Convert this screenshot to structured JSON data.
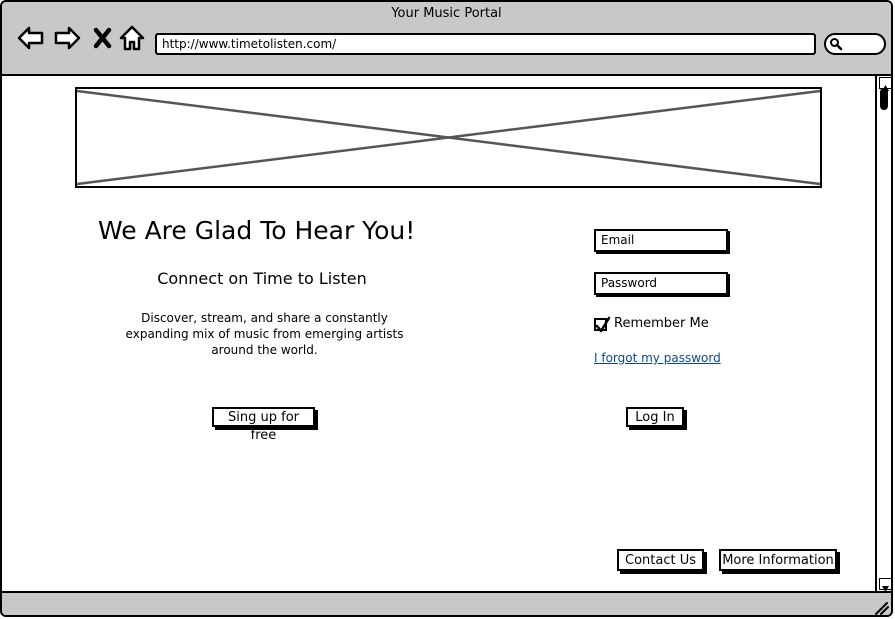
{
  "window": {
    "title": "Your Music Portal"
  },
  "browser": {
    "url": "http://www.timetolisten.com/",
    "icons": [
      "back-arrow-icon",
      "forward-arrow-icon",
      "close-x-icon",
      "home-icon",
      "search-icon"
    ]
  },
  "banner": {
    "icon": "image-placeholder-icon"
  },
  "intro": {
    "heading": "We Are Glad To Hear You!",
    "subheading": "Connect on Time to Listen",
    "description": "Discover, stream, and share a constantly expanding mix of music from emerging artists around the world.",
    "signup_label": "Sing up for free"
  },
  "login": {
    "email_placeholder": "Email",
    "password_placeholder": "Password",
    "remember_label": "Remember Me",
    "remember_checked": true,
    "forgot_label": "I forgot my password",
    "login_label": "Log In"
  },
  "footer": {
    "contact_label": "Contact Us",
    "more_info_label": "More Information"
  },
  "colors": {
    "chrome": "#c8c8c8",
    "link": "#0b4a8e"
  }
}
